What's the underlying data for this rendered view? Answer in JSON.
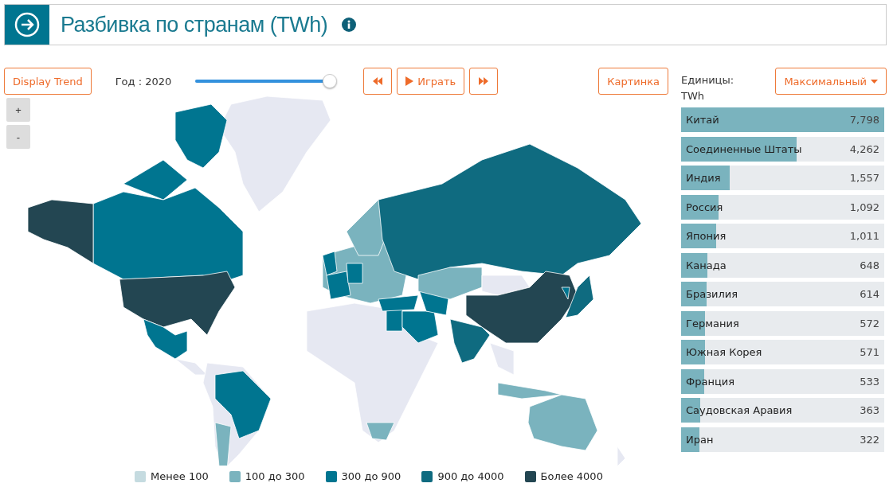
{
  "header": {
    "title": "Разбивка по странам (TWh)"
  },
  "controls": {
    "trend_button": "Display Trend",
    "year_label": "Год : 2020",
    "slider": {
      "level": 1
    },
    "play_button": "Играть",
    "image_button": "Картинка",
    "units_label": "Единицы:",
    "units_value": "TWh",
    "mode_button": "Максимальный"
  },
  "zoom": {
    "plus": "+",
    "minus": "-"
  },
  "legend": [
    {
      "label": "Менее 100",
      "color": "#c5dbe0"
    },
    {
      "label": "100 до 300",
      "color": "#7ab3be"
    },
    {
      "label": "300 до 900",
      "color": "#007590"
    },
    {
      "label": "900 до 4000",
      "color": "#0f6b80"
    },
    {
      "label": "Более 4000",
      "color": "#234652"
    }
  ],
  "ranking": [
    {
      "country": "Китай",
      "value": "7,798",
      "level": 1
    },
    {
      "country": "Соединенные Штаты",
      "value": "4,262",
      "level": 0.57
    },
    {
      "country": "Индия",
      "value": "1,557",
      "level": 0.24
    },
    {
      "country": "Россия",
      "value": "1,092",
      "level": 0.185
    },
    {
      "country": "Япония",
      "value": "1,011",
      "level": 0.173
    },
    {
      "country": "Канада",
      "value": "648",
      "level": 0.13
    },
    {
      "country": "Бразилия",
      "value": "614",
      "level": 0.125
    },
    {
      "country": "Германия",
      "value": "572",
      "level": 0.118
    },
    {
      "country": "Южная Корея",
      "value": "571",
      "level": 0.118
    },
    {
      "country": "Франция",
      "value": "533",
      "level": 0.114
    },
    {
      "country": "Саудовская Аравия",
      "value": "363",
      "level": 0.095
    },
    {
      "country": "Иран",
      "value": "322",
      "level": 0.09
    }
  ]
}
